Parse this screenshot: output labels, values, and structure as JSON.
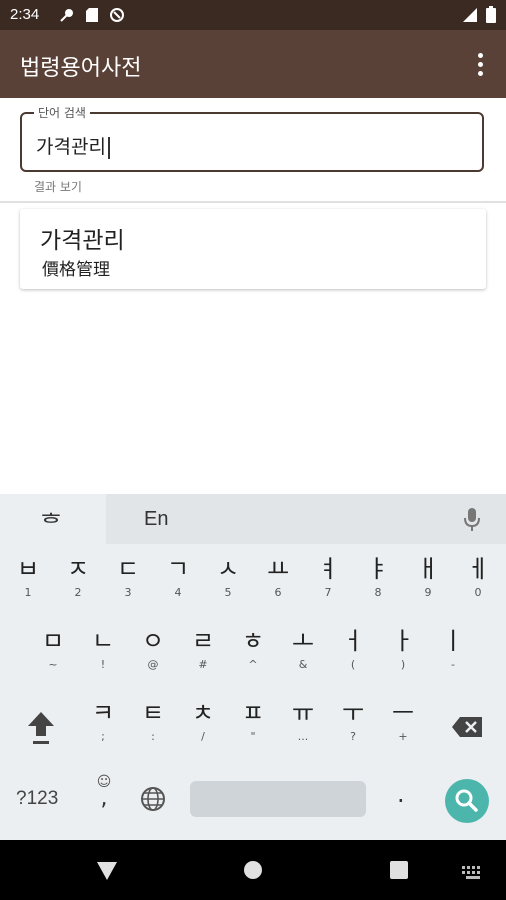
{
  "status_bar": {
    "time": "2:34"
  },
  "app_bar": {
    "title": "법령용어사전",
    "menu_icon": "more-vert-icon"
  },
  "search": {
    "label": "단어 검색",
    "value": "가격관리",
    "helper": "결과 보기"
  },
  "results": [
    {
      "word": "가격관리",
      "hanja": "價格管理"
    }
  ],
  "keyboard": {
    "mode_tab": "ᄒ",
    "lang_tab": "En",
    "row1": [
      {
        "main": "ㅂ",
        "sub": "1"
      },
      {
        "main": "ㅈ",
        "sub": "2"
      },
      {
        "main": "ㄷ",
        "sub": "3"
      },
      {
        "main": "ㄱ",
        "sub": "4"
      },
      {
        "main": "ㅅ",
        "sub": "5"
      },
      {
        "main": "ㅛ",
        "sub": "6"
      },
      {
        "main": "ㅕ",
        "sub": "7"
      },
      {
        "main": "ㅑ",
        "sub": "8"
      },
      {
        "main": "ㅐ",
        "sub": "9"
      },
      {
        "main": "ㅔ",
        "sub": "0"
      }
    ],
    "row2": [
      {
        "main": "ㅁ",
        "sub": "~"
      },
      {
        "main": "ㄴ",
        "sub": "!"
      },
      {
        "main": "ㅇ",
        "sub": "@"
      },
      {
        "main": "ㄹ",
        "sub": "#"
      },
      {
        "main": "ㅎ",
        "sub": "^"
      },
      {
        "main": "ㅗ",
        "sub": "&"
      },
      {
        "main": "ㅓ",
        "sub": "("
      },
      {
        "main": "ㅏ",
        "sub": ")"
      },
      {
        "main": "ㅣ",
        "sub": "-"
      }
    ],
    "row3": [
      {
        "main": "ㅋ",
        "sub": ";"
      },
      {
        "main": "ㅌ",
        "sub": ":"
      },
      {
        "main": "ㅊ",
        "sub": "/"
      },
      {
        "main": "ㅍ",
        "sub": "\""
      },
      {
        "main": "ㅠ",
        "sub": "..."
      },
      {
        "main": "ㅜ",
        "sub": "?"
      },
      {
        "main": "ㅡ",
        "sub": "+"
      }
    ],
    "symbols_key": "?123",
    "comma_key": ",",
    "period_key": "."
  },
  "colors": {
    "status_bar": "#3b2a22",
    "app_bar": "#5a4137",
    "search_key": "#4db6ac",
    "keyboard_bg": "#eceff1"
  }
}
